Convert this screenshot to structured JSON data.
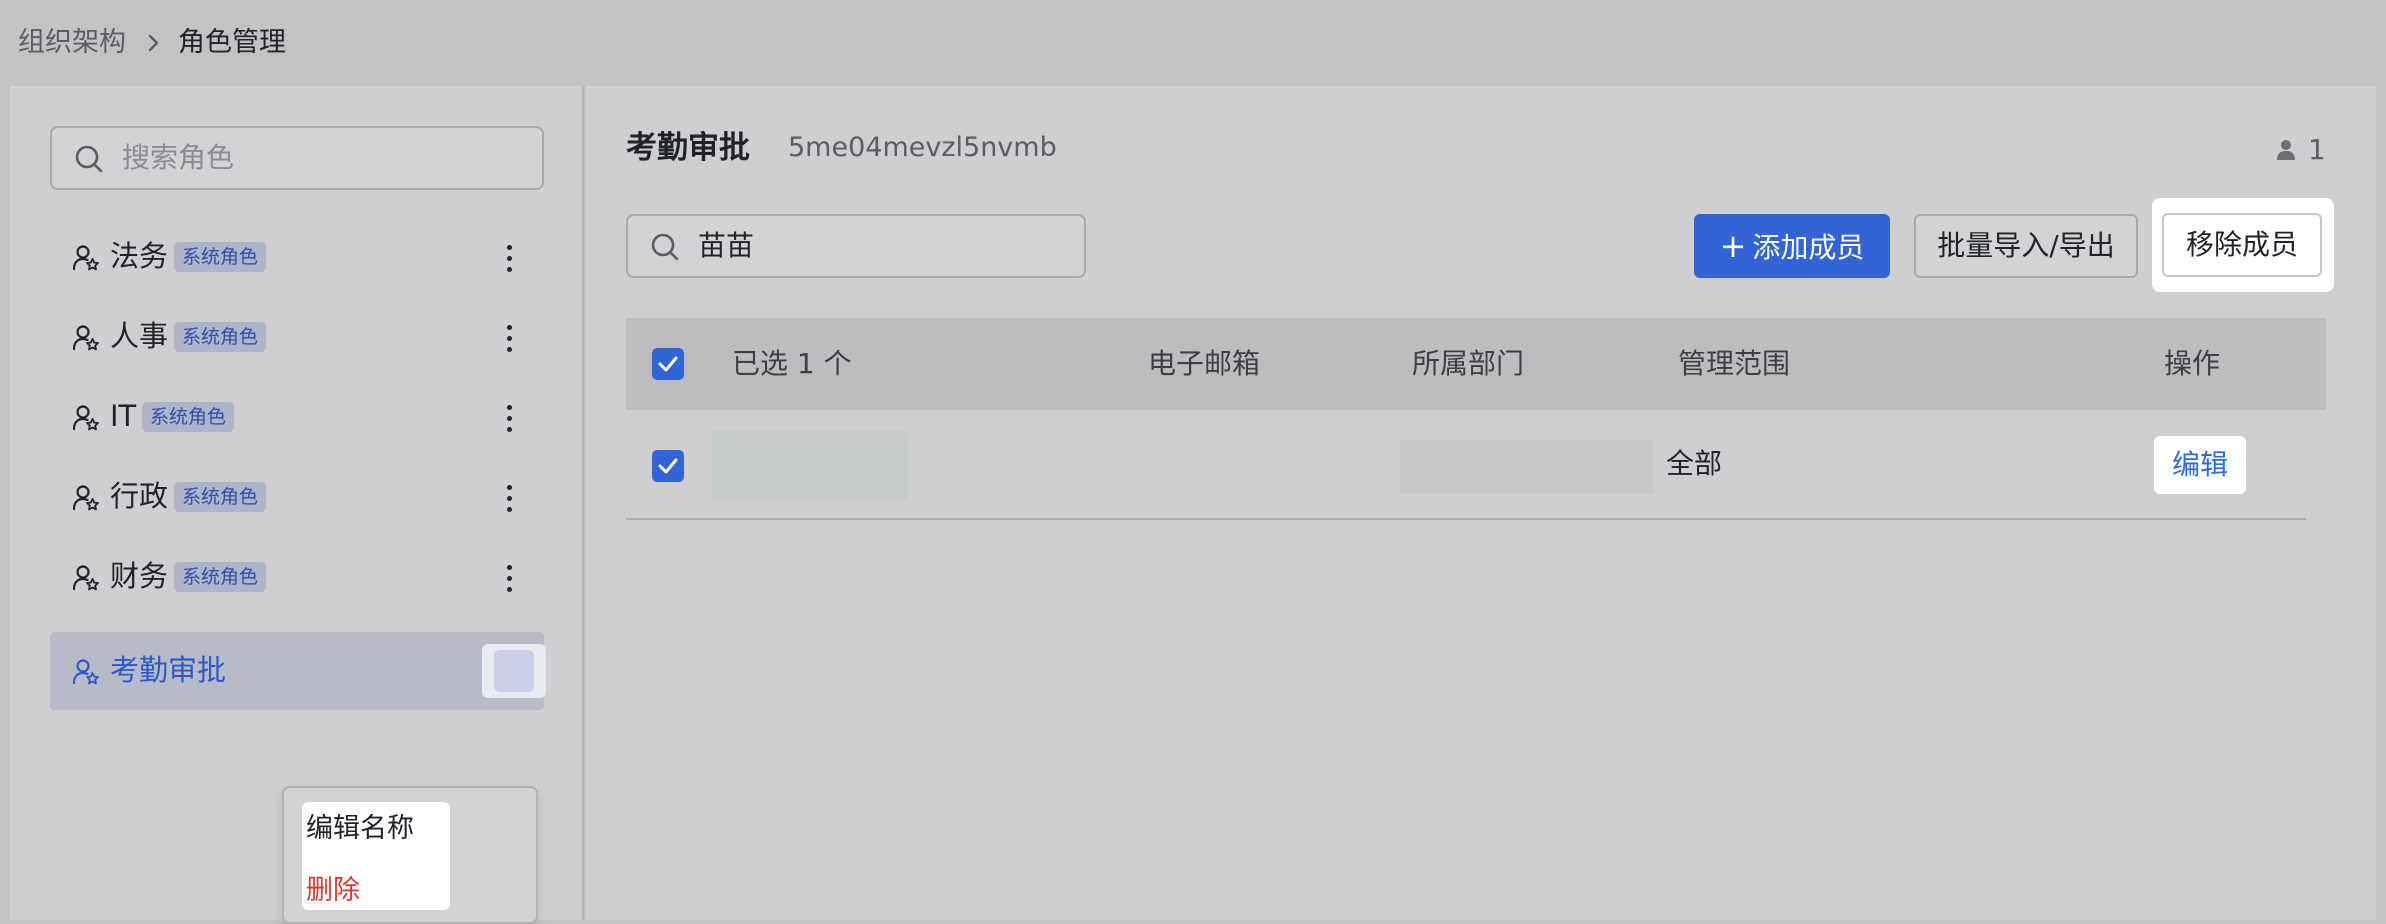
{
  "breadcrumb": {
    "parent": "组织架构",
    "current": "角色管理"
  },
  "sidebar": {
    "search_placeholder": "搜索角色",
    "system_badge": "系统角色",
    "roles": [
      {
        "name": "法务",
        "system": true
      },
      {
        "name": "人事",
        "system": true
      },
      {
        "name": "IT",
        "system": true
      },
      {
        "name": "行政",
        "system": true
      },
      {
        "name": "财务",
        "system": true
      },
      {
        "name": "考勤审批",
        "system": false,
        "active": true
      }
    ],
    "context_menu": {
      "edit_name": "编辑名称",
      "delete": "删除"
    }
  },
  "main": {
    "role_title": "考勤审批",
    "role_id": "5me04mevzl5nvmb",
    "member_count": "1",
    "search_value": "苗苗",
    "buttons": {
      "add_member": "添加成员",
      "bulk_import_export": "批量导入/导出",
      "remove_member": "移除成员"
    },
    "table": {
      "headers": {
        "selected": "已选 1 个",
        "email": "电子邮箱",
        "department": "所属部门",
        "scope": "管理范围",
        "actions": "操作"
      },
      "rows": [
        {
          "scope": "全部",
          "action": "编辑",
          "checked": true
        }
      ]
    }
  },
  "colors": {
    "primary": "#3364d6",
    "danger": "#d83b31",
    "badge_bg": "#aeb5ca",
    "badge_text": "#2e4fa6"
  }
}
